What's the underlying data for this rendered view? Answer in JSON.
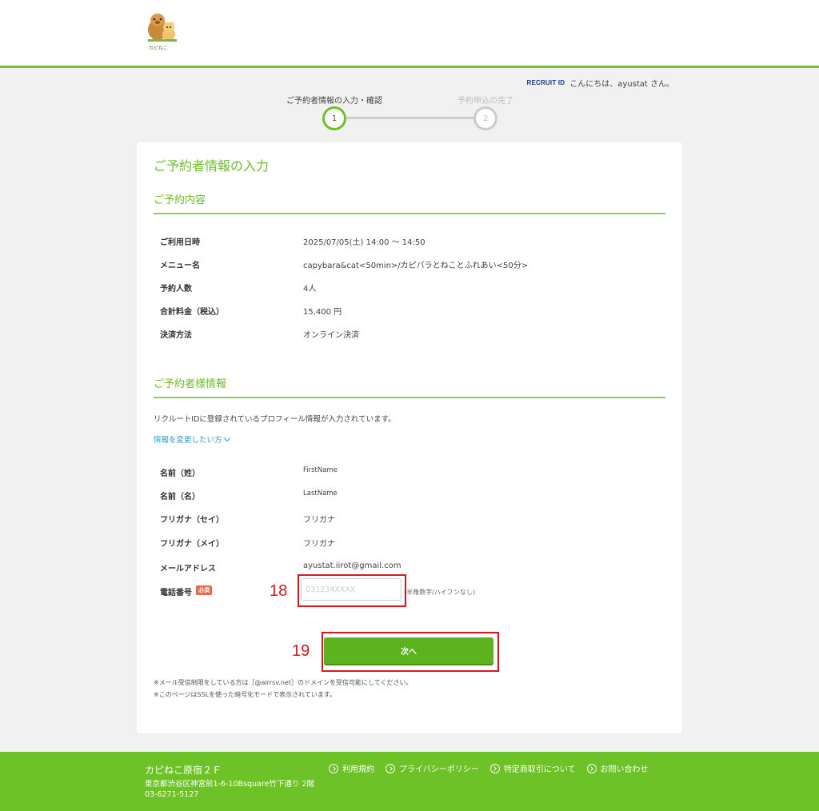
{
  "header": {
    "logo_text": "カピねこ"
  },
  "account": {
    "recruit_logo": "RECRUIT ID",
    "greeting": "こんにちは、ayustat さん。"
  },
  "stepper": {
    "steps": [
      {
        "label": "ご予約者情報の入力・確認",
        "number": "1"
      },
      {
        "label": "予約申込の完了",
        "number": "2"
      }
    ],
    "current_step": 1
  },
  "page_title": "ご予約者情報の入力",
  "reservation": {
    "section_title": "ご予約内容",
    "rows": [
      {
        "label": "ご利用日時",
        "value": "2025/07/05(土) 14:00 〜 14:50"
      },
      {
        "label": "メニュー名",
        "value": "capybara&cat<50min>/カピバラとねことふれあい<50分>"
      },
      {
        "label": "予約人数",
        "value": "4人"
      },
      {
        "label": "合計料金（税込）",
        "value": "15,400 円"
      },
      {
        "label": "決済方法",
        "value": "オンライン決済"
      }
    ]
  },
  "customer": {
    "section_title": "ご予約者様情報",
    "note": "リクルートIDに登録されているプロフィール情報が入力されています。",
    "change_link": "情報を変更したい方",
    "rows": [
      {
        "label": "名前（姓）",
        "value": "FirstName"
      },
      {
        "label": "名前（名）",
        "value": "LastName"
      },
      {
        "label": "フリガナ（セイ）",
        "value": "フリガナ"
      },
      {
        "label": "フリガナ（メイ）",
        "value": "フリガナ"
      },
      {
        "label": "メールアドレス",
        "value": "ayustat.iirot@gmail.com"
      }
    ],
    "phone": {
      "label": "電話番号",
      "required_badge": "必須",
      "value": "",
      "placeholder": "031234XXXX",
      "hint": "(半角数字/ハイフンなし)"
    }
  },
  "next_button": "次へ",
  "footnotes": [
    "※メール受信制限をしている方は［@airrsv.net］のドメインを受信可能にしてください。",
    "※このページはSSLを使った暗号化モードで表示されています。"
  ],
  "annotations": {
    "phone_marker": "18",
    "next_marker": "19",
    "color": "#e0161c"
  },
  "footer": {
    "shop_name": "カピねこ原宿２Ｆ",
    "address": "東京都渋谷区神宮前1-6-10Bsquare竹下通り 2階",
    "tel": "03-6271-5127",
    "links": [
      "利用規約",
      "プライバシーポリシー",
      "特定商取引について",
      "お問い合わせ"
    ]
  },
  "colors": {
    "brand_green": "#6cc226",
    "button_green": "#5db31e",
    "link_blue": "#2a9fd6",
    "required_red": "#e8694a"
  }
}
